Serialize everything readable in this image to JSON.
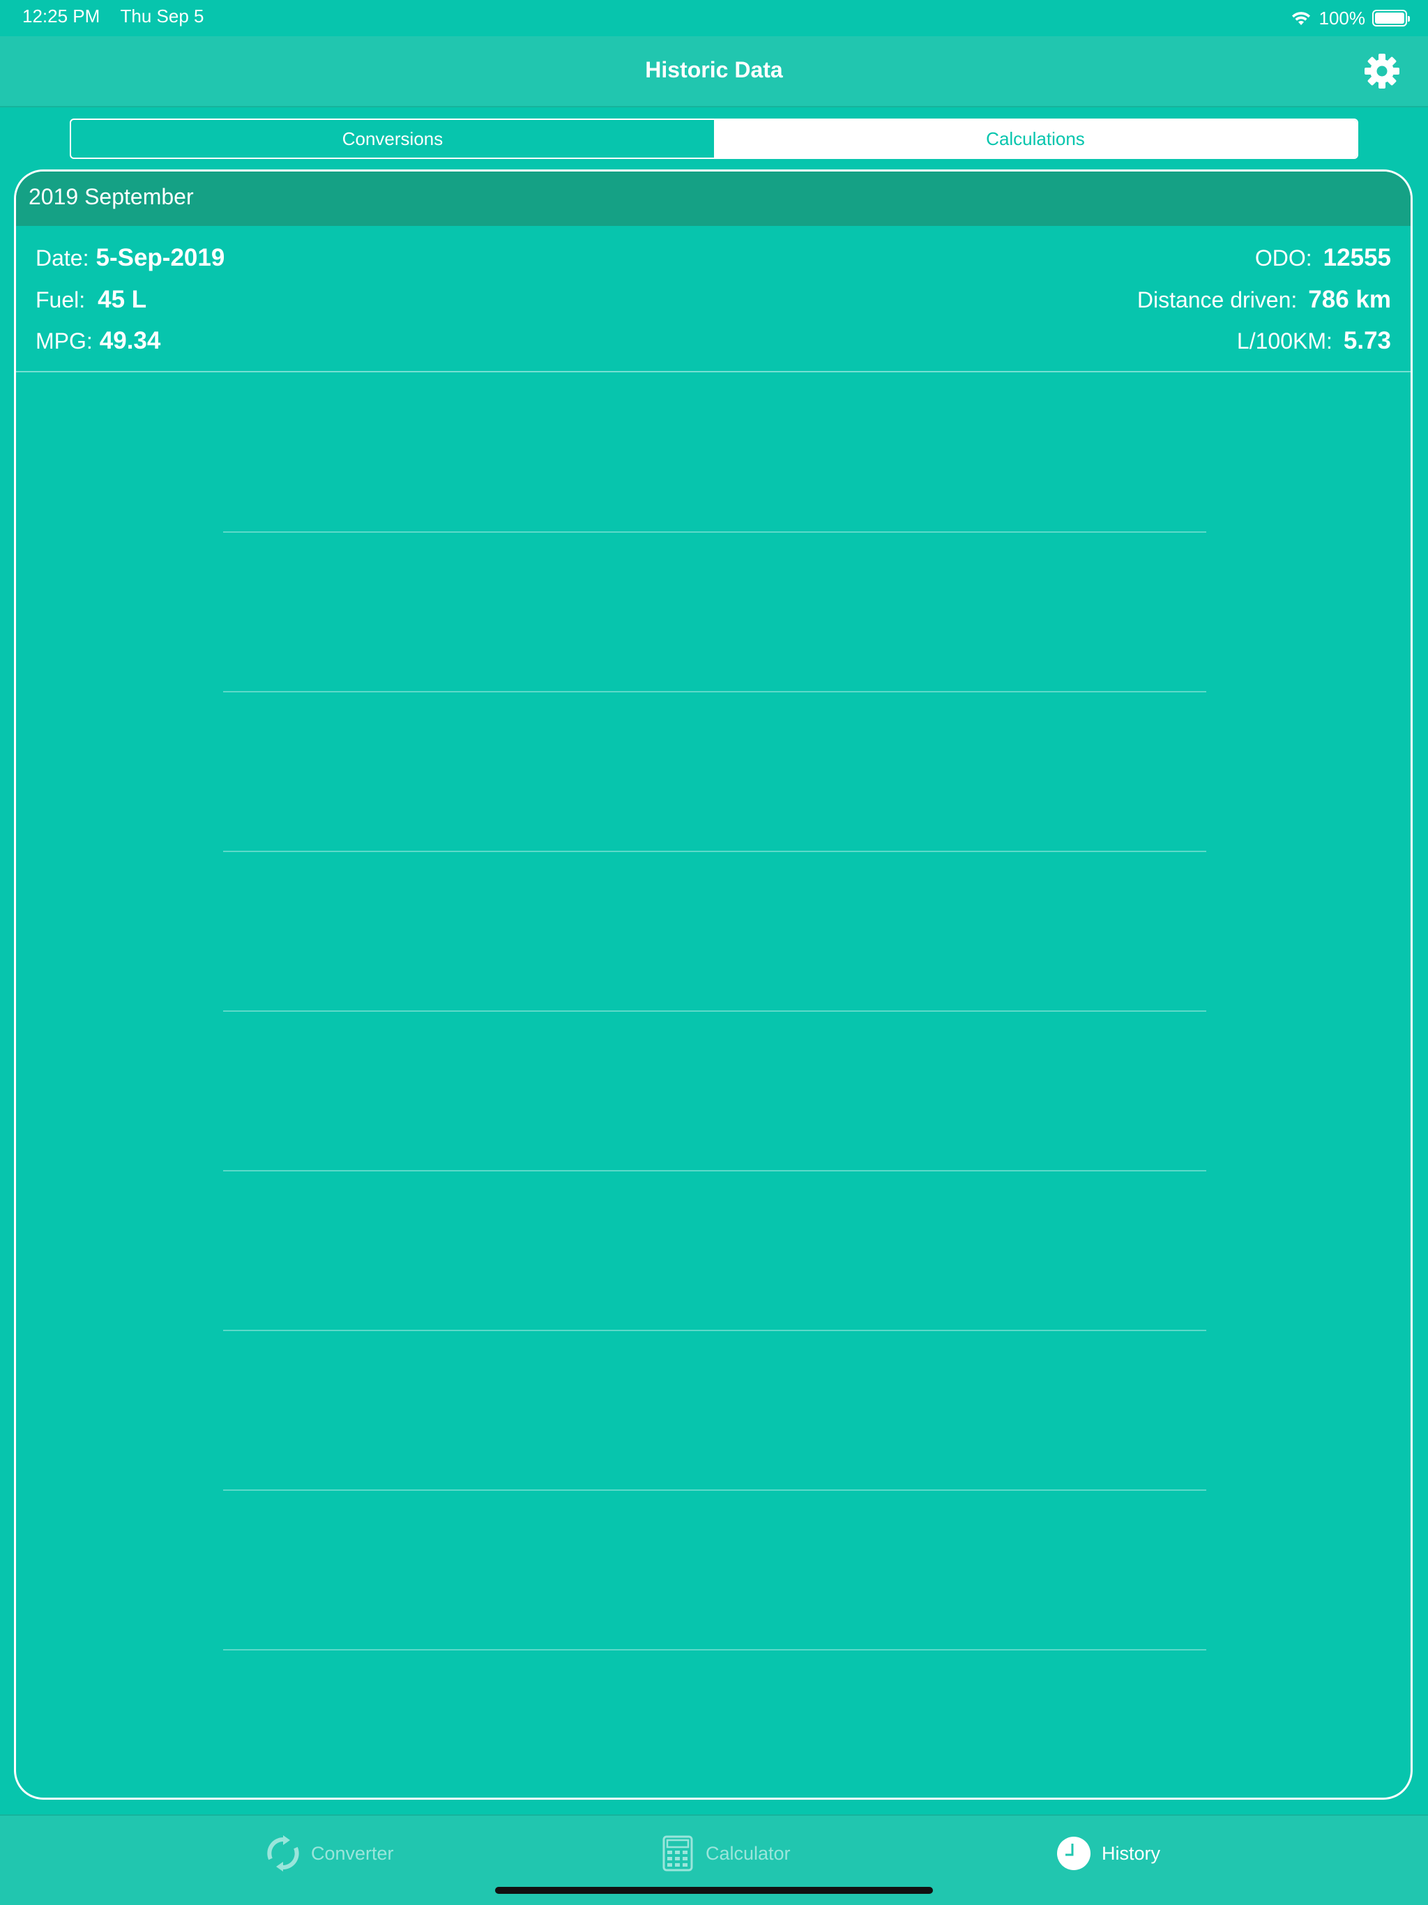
{
  "status_bar": {
    "time": "12:25 PM",
    "date": "Thu Sep 5",
    "battery": "100%",
    "icons": [
      "wifi-icon",
      "battery-icon"
    ]
  },
  "nav": {
    "title": "Historic Data",
    "settings_icon": "gear-icon"
  },
  "segmented": {
    "options": [
      "Conversions",
      "Calculations"
    ],
    "selected": "Calculations"
  },
  "card": {
    "header": "2019 September",
    "left": [
      {
        "label": "Date:",
        "value": "5-Sep-2019"
      },
      {
        "label": "Fuel:",
        "value": "45 L"
      },
      {
        "label": "MPG:",
        "value": "49.34"
      }
    ],
    "right": [
      {
        "label": "ODO:",
        "value": "12555"
      },
      {
        "label": "Distance driven:",
        "value": "786 km"
      },
      {
        "label": "L/100KM:",
        "value": "5.73"
      }
    ]
  },
  "tab_bar": {
    "tabs": [
      {
        "label": "Converter",
        "icon": "refresh-icon",
        "active": false
      },
      {
        "label": "Calculator",
        "icon": "calculator-icon",
        "active": false
      },
      {
        "label": "History",
        "icon": "clock-icon",
        "active": true
      }
    ]
  },
  "colors": {
    "background": "#07C5AD",
    "nav_background": "#21C6AF",
    "card_header": "#15A185",
    "selected_segment_text": "#07C5AD"
  }
}
